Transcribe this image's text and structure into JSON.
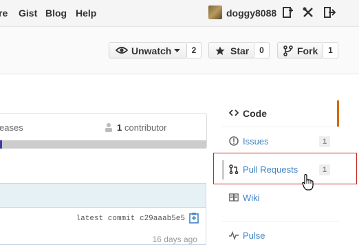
{
  "topnav": {
    "items": [
      "re",
      "Gist",
      "Blog",
      "Help"
    ],
    "username": "doggy8088"
  },
  "repo_actions": {
    "watch": {
      "label": "Unwatch",
      "count": "2"
    },
    "star": {
      "label": "Star",
      "count": "0"
    },
    "fork": {
      "label": "Fork",
      "count": "1"
    }
  },
  "summary": {
    "releases_label": "eases",
    "contributors_count": "1",
    "contributors_label": "contributor"
  },
  "commit": {
    "latest_label": "latest commit",
    "hash": "c29aaab5e5",
    "time": "16 days ago"
  },
  "sidebar": {
    "items": [
      {
        "label": "Code",
        "count": ""
      },
      {
        "label": "Issues",
        "count": "1"
      },
      {
        "label": "Pull Requests",
        "count": "1"
      },
      {
        "label": "Wiki",
        "count": ""
      },
      {
        "label": "Pulse",
        "count": ""
      }
    ],
    "active_index": 0,
    "highlight_color": "#c42a2a",
    "active_accent": "#d26911"
  },
  "colors": {
    "link": "#4183c4",
    "language_bar": "#3c3ca8"
  }
}
